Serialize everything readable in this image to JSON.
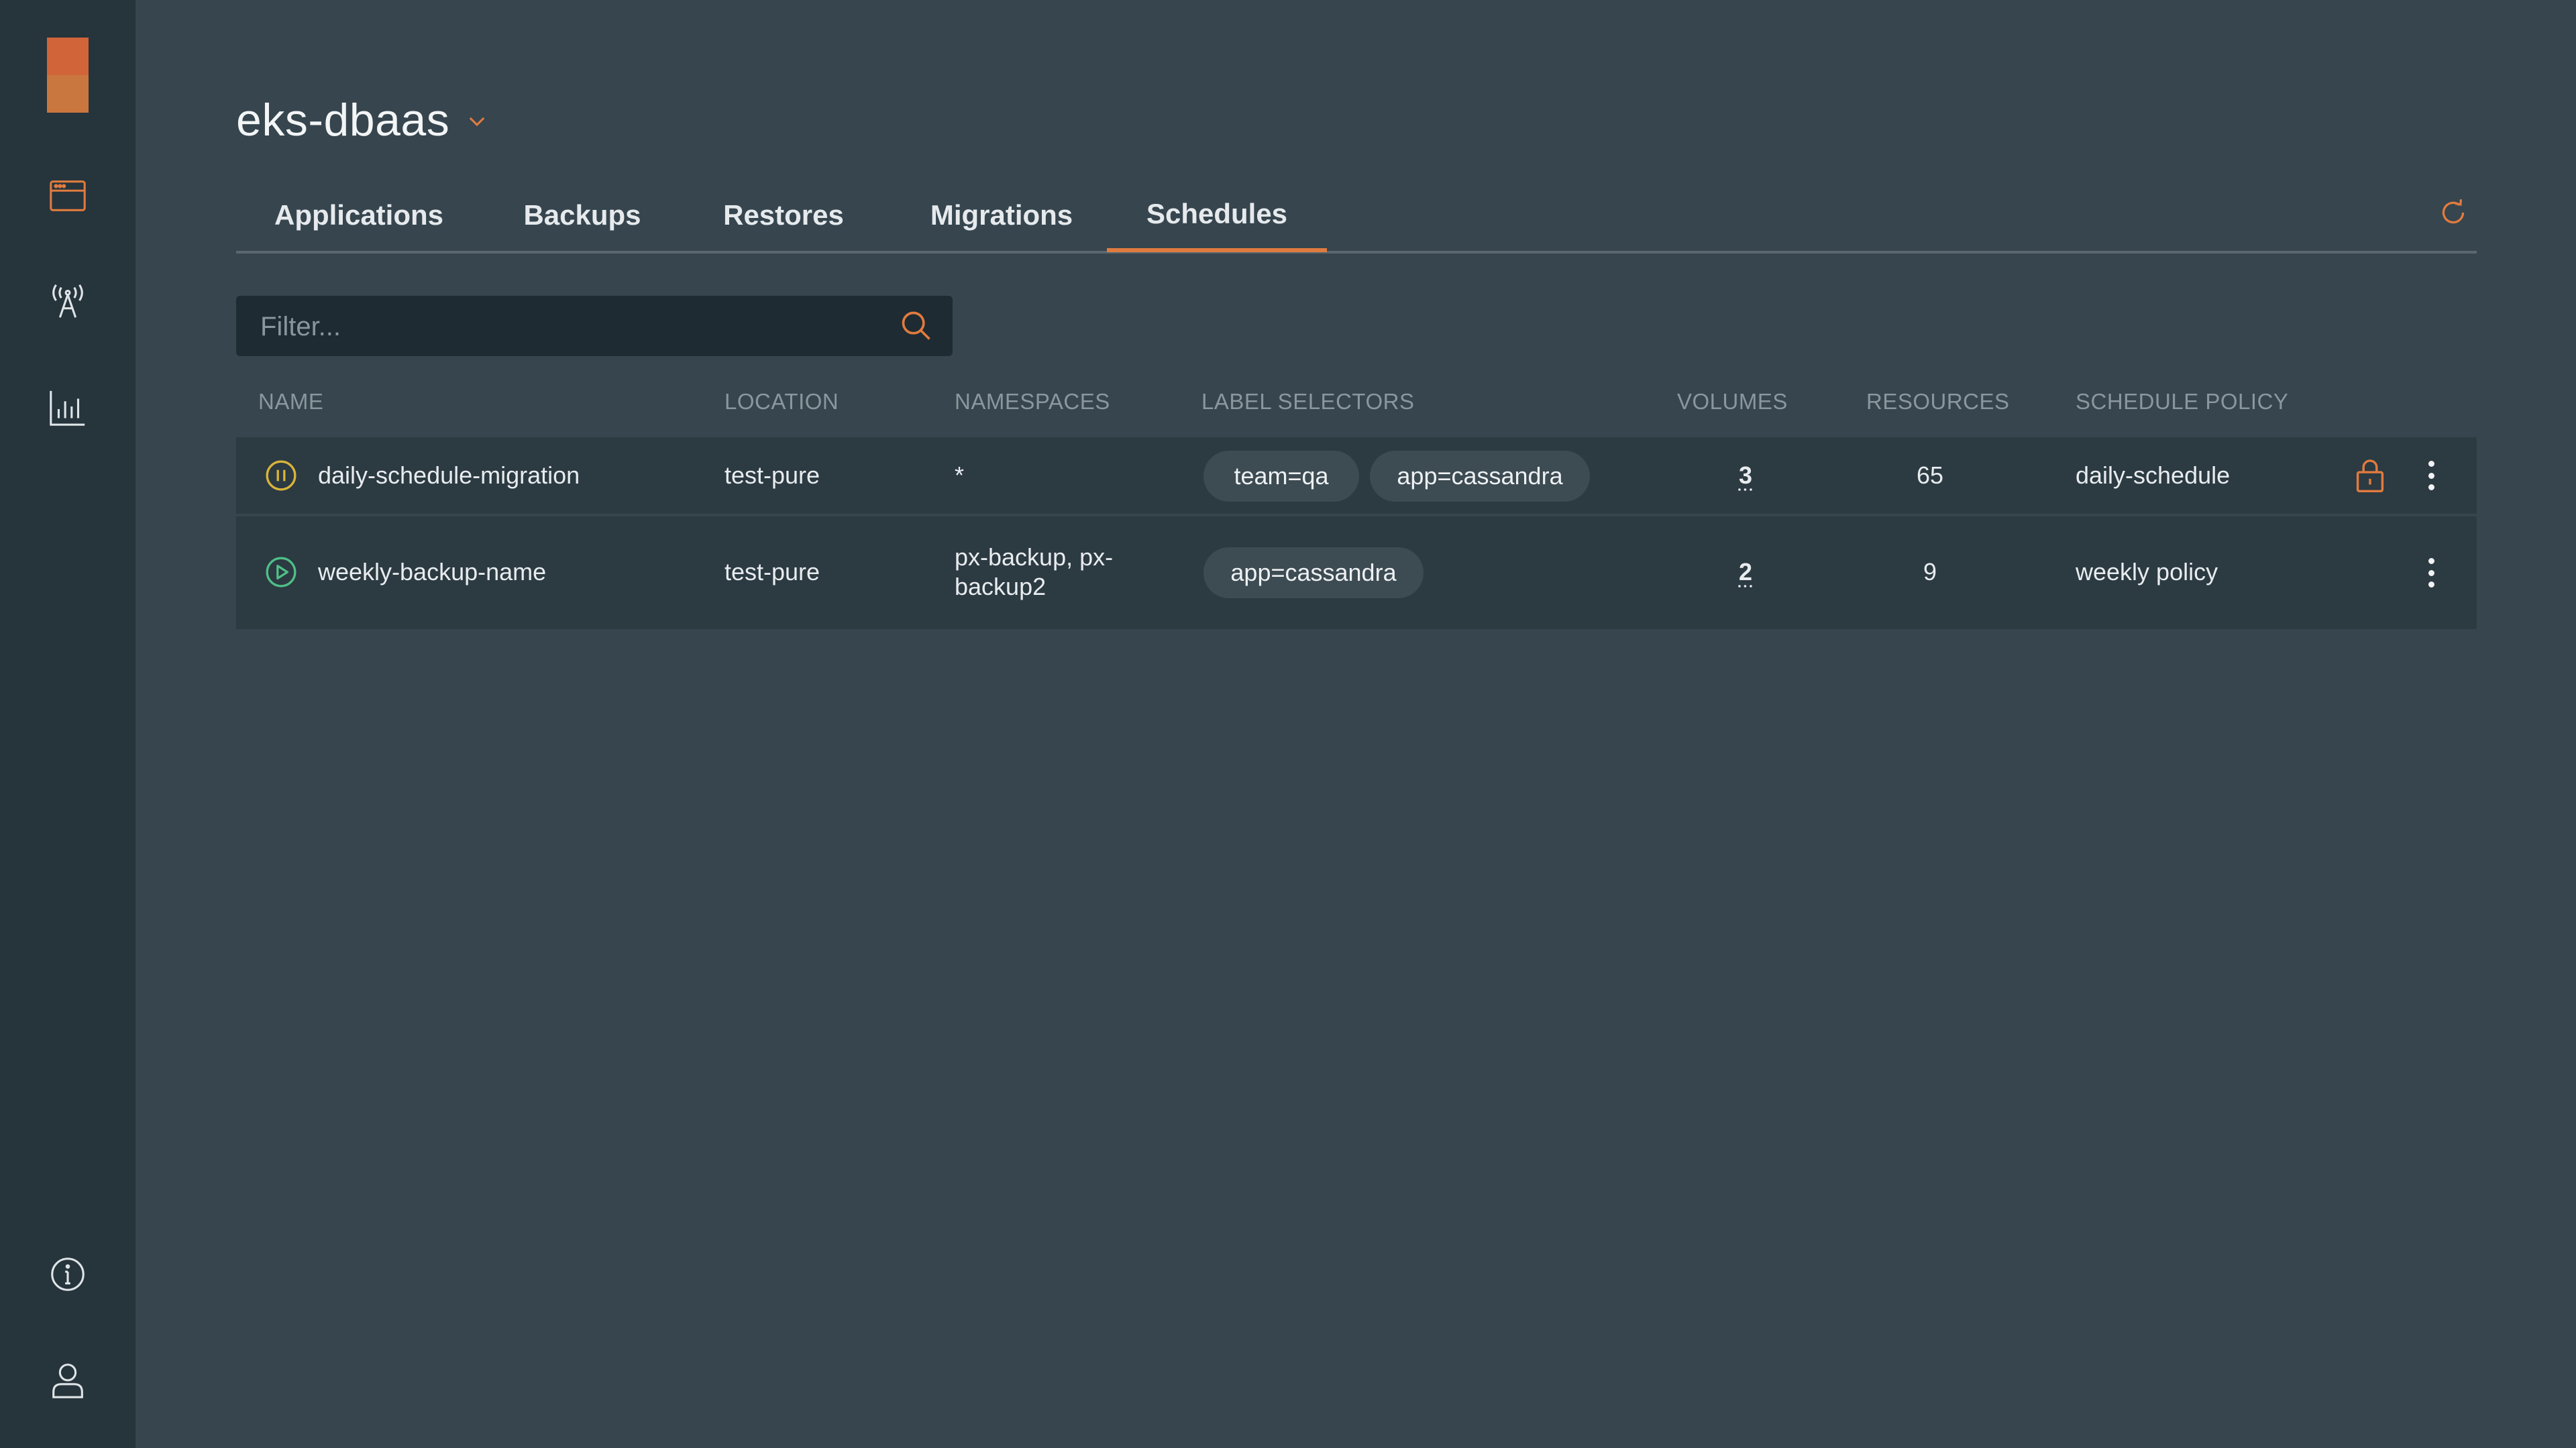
{
  "app": {
    "cluster_name": "eks-dbaas"
  },
  "sidebar": {
    "icons": [
      "logo",
      "applications-icon",
      "antenna-icon",
      "bar-chart-icon",
      "info-icon",
      "user-icon"
    ]
  },
  "tabs": [
    {
      "label": "Applications"
    },
    {
      "label": "Backups"
    },
    {
      "label": "Restores"
    },
    {
      "label": "Migrations"
    },
    {
      "label": "Schedules",
      "active": true
    }
  ],
  "filter": {
    "placeholder": "Filter...",
    "value": ""
  },
  "table": {
    "columns": [
      "NAME",
      "LOCATION",
      "NAMESPACES",
      "LABEL SELECTORS",
      "VOLUMES",
      "RESOURCES",
      "SCHEDULE POLICY"
    ],
    "rows": [
      {
        "status": "paused",
        "name": "daily-schedule-migration",
        "location": "test-pure",
        "namespaces": "*",
        "namespaces_line2": "",
        "labels": [
          "team=qa",
          "app=cassandra"
        ],
        "volumes": "3",
        "resources": "65",
        "policy": "daily-schedule",
        "locked": true
      },
      {
        "status": "running",
        "name": "weekly-backup-name",
        "location": "test-pure",
        "namespaces": "px-backup, px-",
        "namespaces_line2": "backup2",
        "labels": [
          "app=cassandra"
        ],
        "volumes": "2",
        "resources": "9",
        "policy": "weekly policy",
        "locked": false
      }
    ]
  },
  "colors": {
    "accent": "#e07b3f",
    "paused": "#d9b43a",
    "running": "#4fbf86",
    "background": "#36454e",
    "sidebar": "#26343c"
  }
}
